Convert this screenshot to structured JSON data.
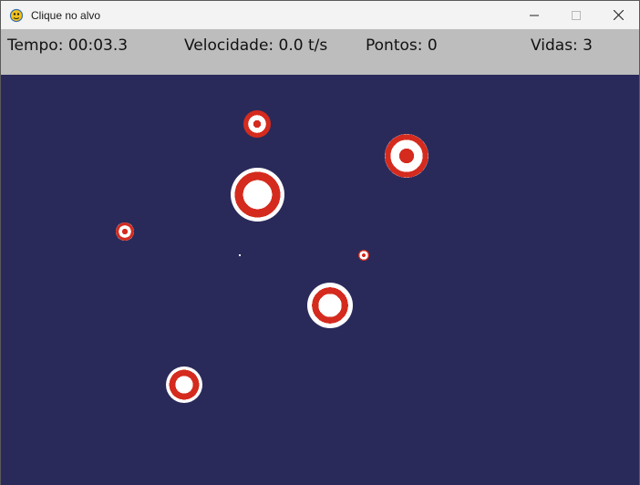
{
  "window": {
    "title": "Clique no alvo",
    "icon": "pygame-snake-icon",
    "controls": [
      "minimize-icon",
      "maximize-icon",
      "close-icon"
    ]
  },
  "hud": {
    "tempo": "Tempo: 00:03.3",
    "velocidade": "Velocidade: 0.0 t/s",
    "pontos": "Pontos: 0",
    "vidas": "Vidas: 3"
  },
  "colors": {
    "playfield": "#2a2a5a",
    "hud": "#bdbdbd",
    "target_red": "#d42b1e",
    "target_white": "#ffffff"
  },
  "targets_count": 7
}
